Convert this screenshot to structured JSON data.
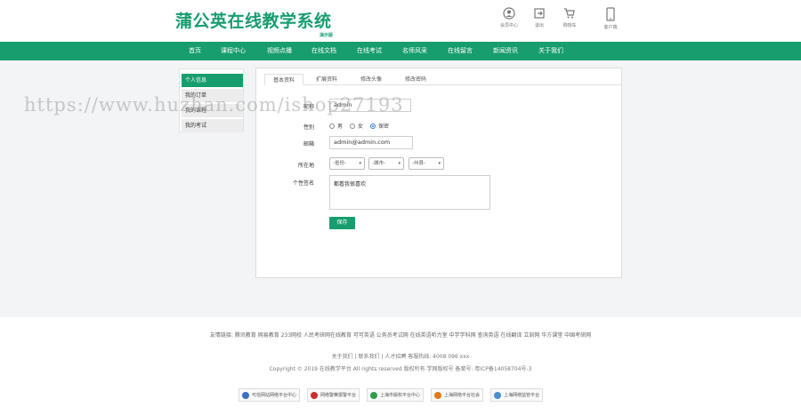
{
  "header": {
    "logo": "蒲公英在线教学系统",
    "logo_sub": "演示版",
    "icons": [
      {
        "label": "会员中心",
        "icon": "user-icon"
      },
      {
        "label": "退出",
        "icon": "logout-icon"
      },
      {
        "label": "购物车",
        "icon": "cart-icon"
      },
      {
        "label": "客户端",
        "icon": "phone-icon"
      }
    ]
  },
  "nav": {
    "items": [
      "首页",
      "课程中心",
      "视频点播",
      "在线文档",
      "在线考试",
      "名师风采",
      "在线留言",
      "新闻资讯",
      "关于我们"
    ]
  },
  "sidebar": {
    "items": [
      "个人信息",
      "我的订单",
      "我的课程",
      "我的考试"
    ]
  },
  "tabs": [
    "基本资料",
    "扩展资料",
    "修改头像",
    "修改密码"
  ],
  "form": {
    "avatar_label": "昵称",
    "avatar_value": "admin",
    "gender_label": "性别",
    "gender_options": [
      "男",
      "女",
      "保密"
    ],
    "gender_selected": "保密",
    "email_label": "邮箱",
    "email_value": "admin@admin.com",
    "region_label": "所在地",
    "region_selects": [
      "-省份-",
      "-城市-",
      "-州县-"
    ],
    "signature_label": "个性签名",
    "signature_value": "都看我很喜欢",
    "save_label": "保存"
  },
  "footer": {
    "links": "友情链接: 腾讯教育  网易教育  233网校  人民考研网在线教育  可可英语  公务员考试网  在线英语听力室  中学学科网  查询英语  在线翻译  立刻网  华方课堂  中国考研网",
    "about": "关于我们 | 联系我们 | 人才招聘   客服热线: 4008 096 xxx",
    "copyright": "Copyright © 2019 在线教学平台 All rights reserved 版权所有  学网版权号 备案号: 粤ICP备14058704号-3",
    "badges": [
      "可信网站网络平台中心",
      "网络警察报警平台",
      "上海市版权平台中心",
      "上海网络平台社会",
      "上海网络监管平台"
    ]
  },
  "watermark": "https://www.huzhan.com/ishop27193",
  "colors": {
    "brand": "#179d6e",
    "radio_selected": "#2a7ae2"
  }
}
